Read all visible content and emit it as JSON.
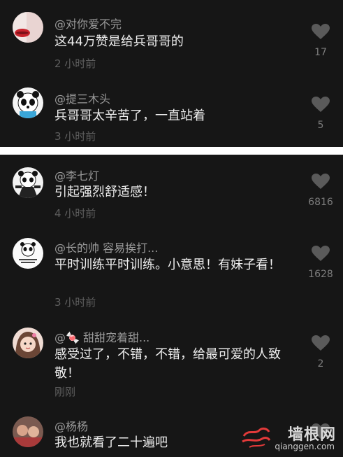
{
  "colors": {
    "background": "#161616",
    "like_icon": "#5a5a5a",
    "divider": "#ffffff"
  },
  "top_comments": [
    {
      "user": "@对你爱不完",
      "text": "这44万赞是给兵哥哥的",
      "time": "2 小时前",
      "likes": "17",
      "avatar_icon": "avatar-lips-icon"
    },
    {
      "user": "@提三木头",
      "text": "兵哥哥太辛苦了，一直站着",
      "time": "3 小时前",
      "likes": "5",
      "avatar_icon": "avatar-panda-icon"
    }
  ],
  "bottom_comments": [
    {
      "user": "@李七灯",
      "text": "引起强烈舒适感！",
      "time": "4 小时前",
      "likes": "6816",
      "avatar_icon": "avatar-kungfu-panda-icon"
    },
    {
      "user": "@长的帅 容易挨打...",
      "text": "平时训练平时训练。小意思！有妹子看！",
      "time": "3 小时前",
      "likes": "1628",
      "avatar_icon": "avatar-panda-meme-icon"
    },
    {
      "user": "@🍬 甜甜宠着甜...",
      "text": "感受过了，不错，不错，给最可爱的人致敬！",
      "time": "刚刚",
      "likes": "2",
      "avatar_icon": "avatar-girl-icon"
    },
    {
      "user": "@杨杨",
      "text": "我也就看了二十遍吧",
      "time": "",
      "likes": "",
      "avatar_icon": "avatar-photo-icon"
    }
  ],
  "watermark": {
    "title": "墙根网",
    "url": "qianggen.com",
    "logo_icon": "cloud-logo-icon"
  }
}
